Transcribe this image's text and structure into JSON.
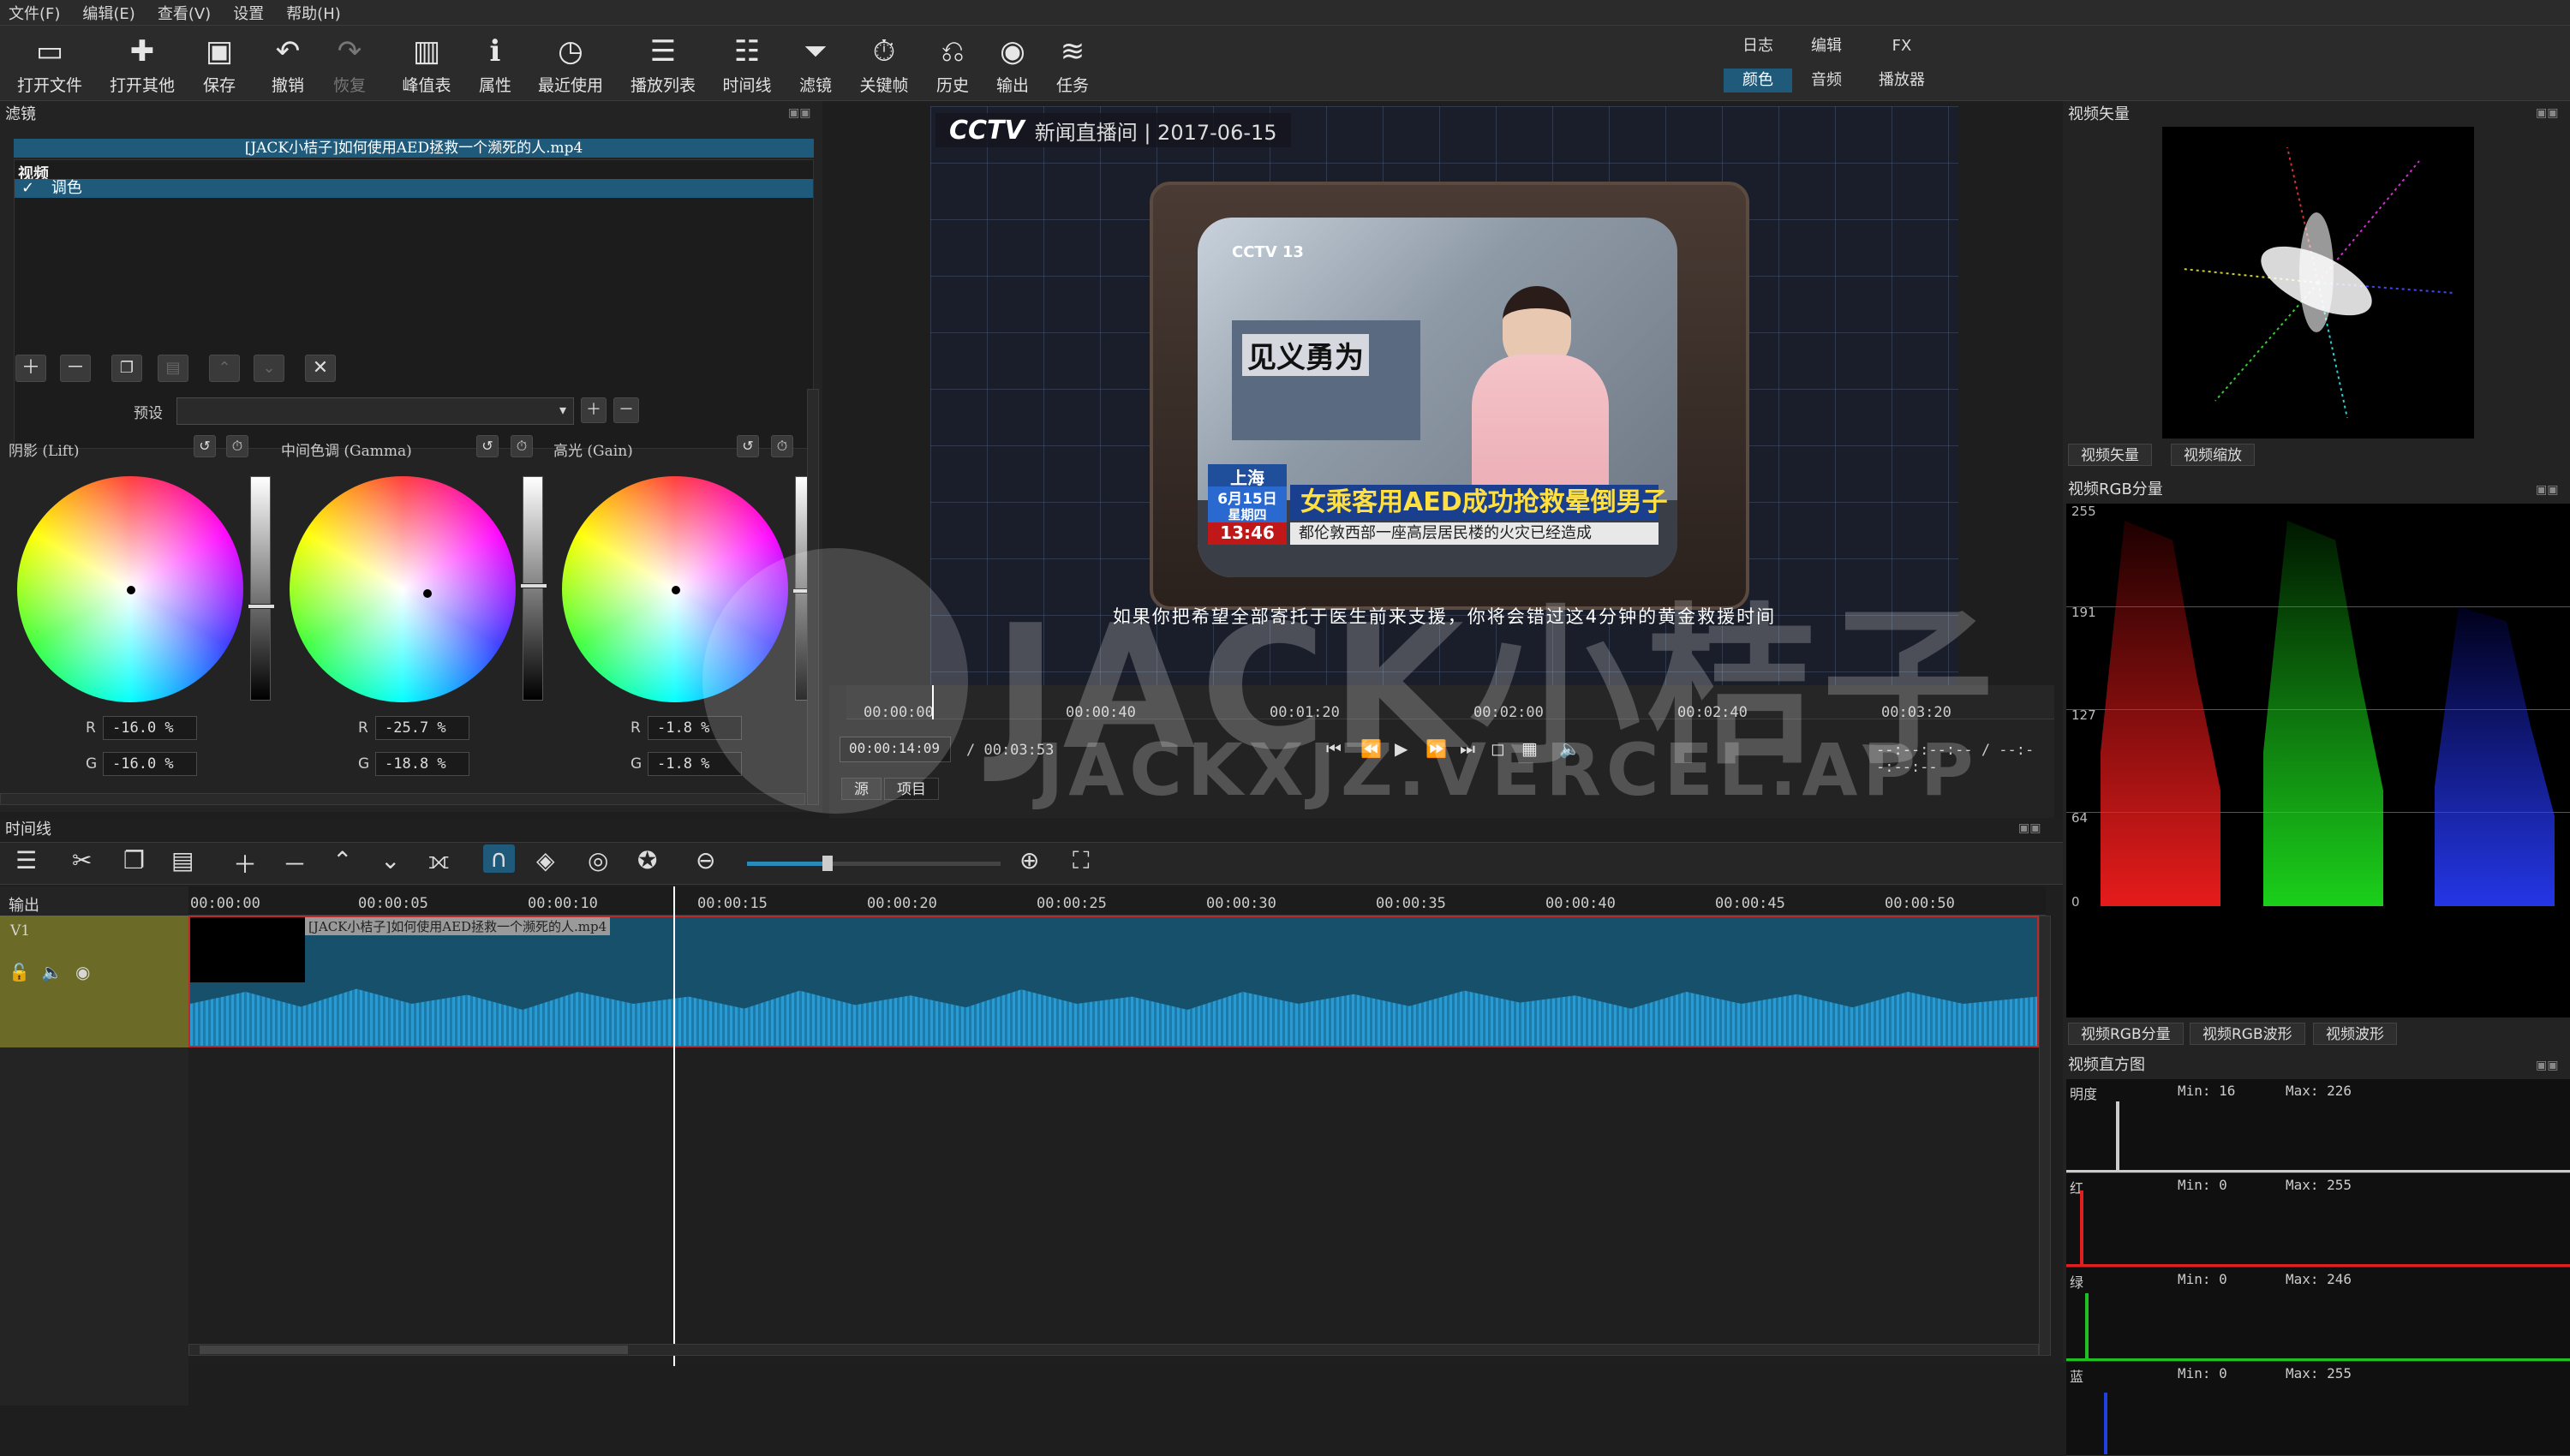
{
  "menu": [
    "文件(F)",
    "编辑(E)",
    "查看(V)",
    "设置",
    "帮助(H)"
  ],
  "toolbar": [
    {
      "label": "打开文件",
      "icon": "folder-open-icon"
    },
    {
      "label": "打开其他",
      "icon": "open-other-icon"
    },
    {
      "label": "保存",
      "icon": "save-icon"
    },
    {
      "label": "撤销",
      "icon": "undo-icon"
    },
    {
      "label": "恢复",
      "icon": "redo-icon"
    },
    {
      "label": "峰值表",
      "icon": "peak-meter-icon"
    },
    {
      "label": "属性",
      "icon": "info-icon"
    },
    {
      "label": "最近使用",
      "icon": "clock-icon"
    },
    {
      "label": "播放列表",
      "icon": "playlist-icon"
    },
    {
      "label": "时间线",
      "icon": "timeline-icon"
    },
    {
      "label": "滤镜",
      "icon": "filter-icon"
    },
    {
      "label": "关键帧",
      "icon": "stopwatch-icon"
    },
    {
      "label": "历史",
      "icon": "history-icon"
    },
    {
      "label": "输出",
      "icon": "disc-icon"
    },
    {
      "label": "任务",
      "icon": "jobs-icon"
    }
  ],
  "layouts": {
    "row1": [
      "日志",
      "编辑",
      "FX"
    ],
    "row2": [
      "颜色",
      "音频",
      "播放器"
    ],
    "active": "颜色"
  },
  "filters": {
    "title": "滤镜",
    "clip": "[JACK小桔子]如何使用AED拯救一个濒死的人.mp4",
    "category": "视频",
    "item": "调色",
    "preset_label": "预设",
    "wheels": [
      {
        "title": "阴影 (Lift)",
        "r": "-16.0 %",
        "g": "-16.0 %"
      },
      {
        "title": "中间色调 (Gamma)",
        "r": "-25.7 %",
        "g": "-18.8 %"
      },
      {
        "title": "高光 (Gain)",
        "r": "-1.8 %",
        "g": "-1.8 %"
      }
    ],
    "r_label": "R",
    "g_label": "G"
  },
  "viewer": {
    "channel": "CCTV",
    "broadcast": "新闻直播间 | 2017-06-15",
    "inner_logo": "CCTV 13",
    "tag": "见义勇为",
    "city": "上海",
    "date": "6月15日",
    "weekday": "星期四",
    "time": "13:46",
    "headline": "女乘客用AED成功抢救晕倒男子",
    "ticker": "都伦敦西部一座高层居民楼的火灾已经造成",
    "subtitle": "如果你把希望全部寄托于医生前来支援，你将会错过这4分钟的黄金救援时间"
  },
  "transport": {
    "ticks": [
      "00:00:00",
      "00:00:40",
      "00:01:20",
      "00:02:00",
      "00:02:40",
      "00:03:20"
    ],
    "position": "00:00:14:09",
    "duration": "/ 00:03:53",
    "inout": "--:--:--:-- / --:--:--:--",
    "tabs": [
      "源",
      "项目"
    ]
  },
  "scopes": {
    "vector_title": "视频矢量",
    "vector_tabs": [
      "视频矢量",
      "视频缩放"
    ],
    "rgb_title": "视频RGB分量",
    "rgb_levels": [
      "255",
      "191",
      "127",
      "64",
      "0"
    ],
    "rgb_tabs": [
      "视频RGB分量",
      "视频RGB波形",
      "视频波形"
    ],
    "hist_title": "视频直方图",
    "hist": [
      {
        "name": "明度",
        "min": "Min: 16",
        "max": "Max: 226",
        "color": "#cccccc"
      },
      {
        "name": "红",
        "min": "Min: 0",
        "max": "Max: 255",
        "color": "#e02020"
      },
      {
        "name": "绿",
        "min": "Min: 0",
        "max": "Max: 246",
        "color": "#20c020"
      },
      {
        "name": "蓝",
        "min": "Min: 0",
        "max": "Max: 255",
        "color": "#2040e0"
      }
    ]
  },
  "timeline": {
    "title": "时间线",
    "output": "输出",
    "track": "V1",
    "clip": "[JACK小桔子]如何使用AED拯救一个濒死的人.mp4",
    "ticks": [
      "00:00:00",
      "00:00:05",
      "00:00:10",
      "00:00:15",
      "00:00:20",
      "00:00:25",
      "00:00:30",
      "00:00:35",
      "00:00:40",
      "00:00:45",
      "00:00:50"
    ]
  },
  "watermark": {
    "big": "JACK小桔子",
    "small": "JACKXJZ.VERCEL.APP"
  }
}
